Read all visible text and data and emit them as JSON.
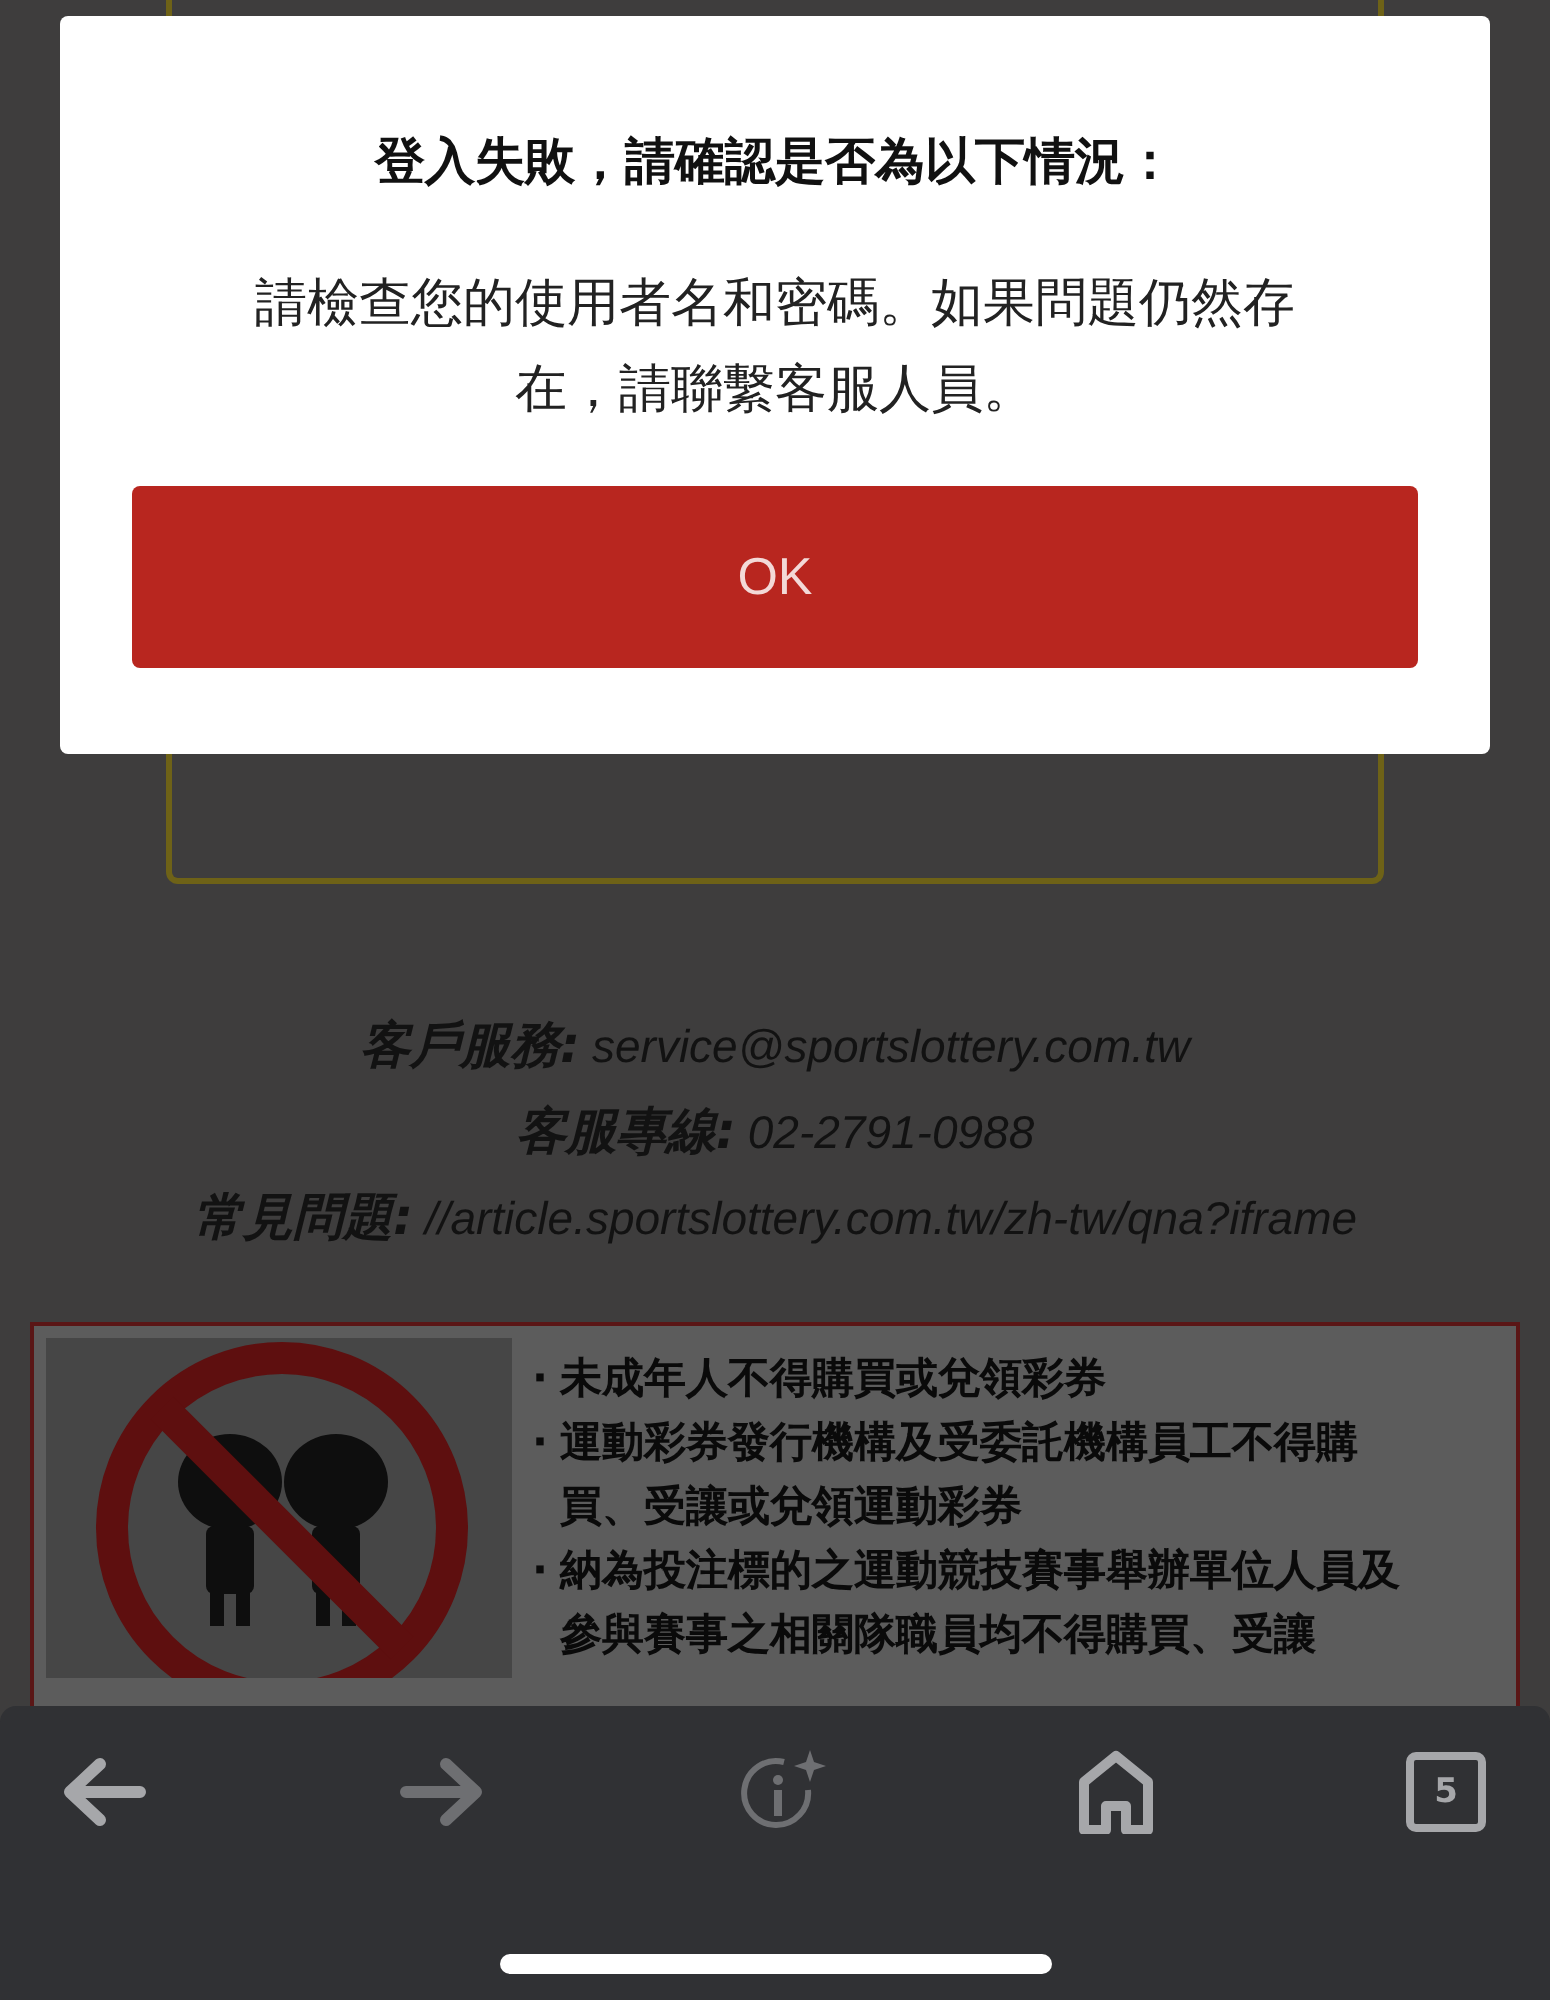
{
  "dialog": {
    "title": "登入失敗，請確認是否為以下情況：",
    "message": "請檢查您的使用者名和密碼。如果問題仍然存在，請聯繫客服人員。",
    "button": "OK"
  },
  "contacts": [
    {
      "label": "客戶服務:",
      "value": "service@sportslottery.com.tw"
    },
    {
      "label": "客服專線:",
      "value": "02-2791-0988"
    },
    {
      "label": "常見問題:",
      "value": "//article.sportslottery.com.tw/zh-tw/qna?iframe"
    }
  ],
  "notice": {
    "items": [
      {
        "bullet": "·",
        "text": "未成年人不得購買或兌領彩券"
      },
      {
        "bullet": "·",
        "text": "運動彩券發行機構及受委託機構員工不得購買、受讓或兌領運動彩券"
      },
      {
        "bullet": "·",
        "text": "納為投注標的之運動競技賽事舉辦單位人員及參與賽事之相關隊職員均不得購買、受讓"
      }
    ]
  },
  "toolbar": {
    "back": {
      "disabled": false
    },
    "forward": {
      "disabled": true
    },
    "tab_count": "5"
  }
}
